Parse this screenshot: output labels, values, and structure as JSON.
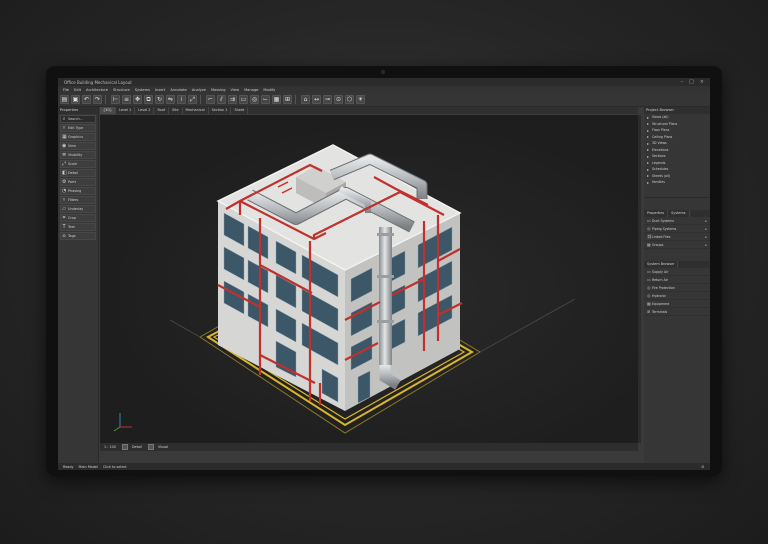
{
  "window": {
    "title": "Office Building Mechanical Layout",
    "controls": [
      "minimize-icon",
      "maximize-icon",
      "close-icon"
    ]
  },
  "menu": [
    "File",
    "Edit",
    "Architecture",
    "Structure",
    "Systems",
    "Insert",
    "Annotate",
    "Analyze",
    "Massing",
    "View",
    "Manage",
    "Modify"
  ],
  "toolbar": {
    "icons": [
      "open-icon",
      "save-icon",
      "undo-icon",
      "redo-icon",
      "measure-icon",
      "align-icon",
      "move-icon",
      "copy-icon",
      "rotate-icon",
      "mirror-icon",
      "array-icon",
      "scale-icon",
      "trim-icon",
      "split-icon",
      "offset-icon",
      "duct-icon",
      "pipe-icon",
      "fitting-icon",
      "equipment-icon",
      "terminal-icon",
      "tag-icon",
      "dimension-icon",
      "section-icon",
      "elevation-icon",
      "3d-view-icon",
      "render-icon"
    ]
  },
  "left_panel": {
    "header": "Properties",
    "rows": [
      {
        "icon": "search-icon",
        "label": "Search..."
      },
      {
        "icon": "filter-icon",
        "label": "Edit Type"
      },
      {
        "icon": "grid-icon",
        "label": "Graphics"
      },
      {
        "icon": "eye-icon",
        "label": "View"
      },
      {
        "icon": "layers-icon",
        "label": "Visibility"
      },
      {
        "icon": "scale-icon",
        "label": "Scale"
      },
      {
        "icon": "detail-icon",
        "label": "Detail"
      },
      {
        "icon": "parts-icon",
        "label": "Parts"
      },
      {
        "icon": "phase-icon",
        "label": "Phasing"
      },
      {
        "icon": "filter-icon",
        "label": "Filters"
      },
      {
        "icon": "underlay-icon",
        "label": "Underlay"
      },
      {
        "icon": "crop-icon",
        "label": "Crop"
      },
      {
        "icon": "text-icon",
        "label": "Text"
      },
      {
        "icon": "tag-icon",
        "label": "Tags"
      }
    ]
  },
  "view_tabs": [
    {
      "label": "{3D}",
      "active": true
    },
    {
      "label": "Level 1"
    },
    {
      "label": "Level 2"
    },
    {
      "label": "Roof"
    },
    {
      "label": "Site"
    },
    {
      "label": "Mechanical"
    },
    {
      "label": "Section 1"
    },
    {
      "label": "Sheet"
    }
  ],
  "viewport_status": {
    "scale": "1 : 100",
    "items": [
      "Detail",
      "Visual"
    ]
  },
  "right_panel": {
    "header": "Project Browser",
    "tree": [
      {
        "icon": "folder-icon",
        "label": "Views (all)"
      },
      {
        "icon": "folder-icon",
        "label": "Structural Plans"
      },
      {
        "icon": "folder-icon",
        "label": "Floor Plans"
      },
      {
        "icon": "folder-icon",
        "label": "Ceiling Plans"
      },
      {
        "icon": "folder-icon",
        "label": "3D Views"
      },
      {
        "icon": "folder-icon",
        "label": "Elevations"
      },
      {
        "icon": "folder-icon",
        "label": "Sections"
      },
      {
        "icon": "folder-icon",
        "label": "Legends"
      },
      {
        "icon": "folder-icon",
        "label": "Schedules"
      },
      {
        "icon": "folder-icon",
        "label": "Sheets (all)"
      },
      {
        "icon": "folder-icon",
        "label": "Families"
      }
    ],
    "tabs": [
      "Properties",
      "Systems"
    ],
    "props": [
      {
        "icon": "duct-icon",
        "label": "Duct Systems",
        "val": "▸"
      },
      {
        "icon": "pipe-icon",
        "label": "Piping Systems",
        "val": "▸"
      },
      {
        "icon": "link-icon",
        "label": "Linked Files",
        "val": "▸"
      },
      {
        "icon": "group-icon",
        "label": "Groups",
        "val": "▸"
      }
    ],
    "system_header": "System Browser",
    "systems": [
      {
        "icon": "duct-icon",
        "label": "Supply Air"
      },
      {
        "icon": "duct-icon",
        "label": "Return Air"
      },
      {
        "icon": "pipe-icon",
        "label": "Fire Protection"
      },
      {
        "icon": "pipe-icon",
        "label": "Hydronic"
      },
      {
        "icon": "equipment-icon",
        "label": "Equipment"
      },
      {
        "icon": "terminal-icon",
        "label": "Terminals"
      }
    ]
  },
  "status_bar": {
    "left": [
      "Ready",
      "Main Model"
    ],
    "center": "Click to select",
    "right": ":0"
  },
  "colors": {
    "pipe_red": "#c0302c",
    "boundary_yellow": "#d8b52a",
    "glass": "#3c5768",
    "wall": "#d6d6d4",
    "duct": "#b8bcbf"
  }
}
